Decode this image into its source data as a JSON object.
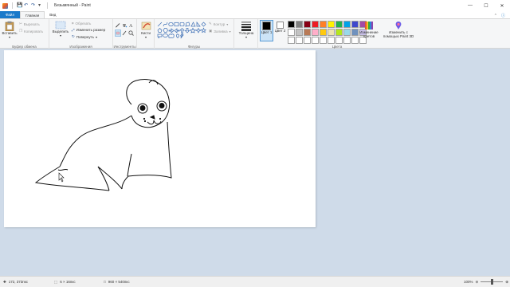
{
  "window": {
    "title": "Безымянный - Paint"
  },
  "tabs": [
    {
      "label": "Файл"
    },
    {
      "label": "Главная"
    },
    {
      "label": "Вид"
    }
  ],
  "clipboard": {
    "paste_label": "Вставить",
    "cut_label": "Вырезать",
    "copy_label": "Копировать",
    "group_label": "Буфер обмена"
  },
  "image": {
    "select_label": "Выделить",
    "crop_label": "Обрезать",
    "resize_label": "Изменить размер",
    "rotate_label": "Повернуть",
    "group_label": "Изображения"
  },
  "tools": {
    "group_label": "Инструменты"
  },
  "brushes": {
    "label": "Кисти"
  },
  "shapes": {
    "outline_label": "Контур",
    "fill_label": "Заливка",
    "group_label": "Фигуры"
  },
  "size": {
    "label": "Толщина"
  },
  "colors": {
    "color1_label": "Цвет 1",
    "color2_label": "Цвет 2",
    "edit_label": "Изменение цветов",
    "paint3d_label": "Изменить с помощью Paint 3D",
    "group_label": "Цвета",
    "color1": "#000000",
    "color2": "#ffffff",
    "palette": [
      "#000000",
      "#7f7f7f",
      "#880015",
      "#ed1c24",
      "#ff7f27",
      "#fff200",
      "#22b14c",
      "#00a2e8",
      "#3f48cc",
      "#a349a4",
      "#ffffff",
      "#c3c3c3",
      "#b97a57",
      "#ffaec9",
      "#ffc90e",
      "#efe4b0",
      "#b5e61d",
      "#99d9ea",
      "#7092be",
      "#c8bfe7",
      "#ffffff",
      "#ffffff",
      "#ffffff",
      "#ffffff",
      "#ffffff",
      "#ffffff",
      "#ffffff",
      "#ffffff",
      "#ffffff",
      "#ffffff"
    ]
  },
  "status": {
    "cursor_pos": "172, 373пкс",
    "selection_size": "6 × 16пкс",
    "image_size": "960 × 540пкс",
    "zoom": "100%"
  }
}
